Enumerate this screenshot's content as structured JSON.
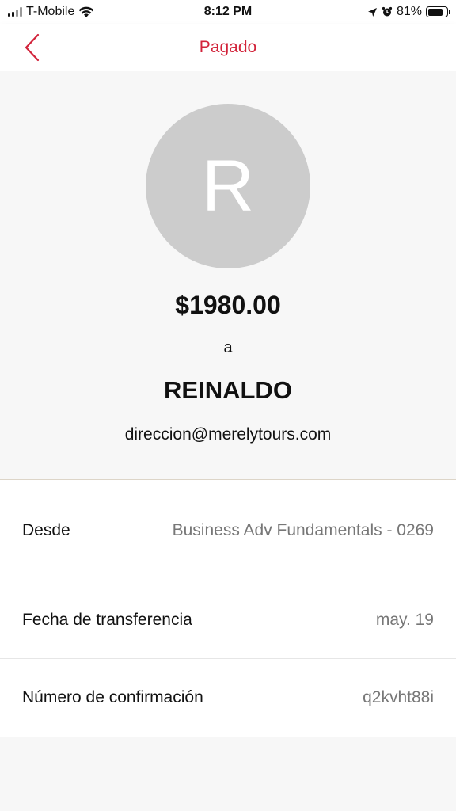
{
  "status_bar": {
    "carrier": "T-Mobile",
    "time": "8:12 PM",
    "battery": "81%",
    "battery_level": 0.81
  },
  "nav": {
    "title": "Pagado",
    "accent_color": "#d2233a"
  },
  "payment": {
    "avatar_initial": "R",
    "amount": "$1980.00",
    "connector": "a",
    "recipient": "REINALDO",
    "email": "direccion@merelytours.com"
  },
  "details": [
    {
      "label": "Desde",
      "value": "Business Adv Fundamentals - 0269"
    },
    {
      "label": "Fecha de transferencia",
      "value": "may. 19"
    },
    {
      "label": "Número de confirmación",
      "value": "q2kvht88i"
    }
  ]
}
